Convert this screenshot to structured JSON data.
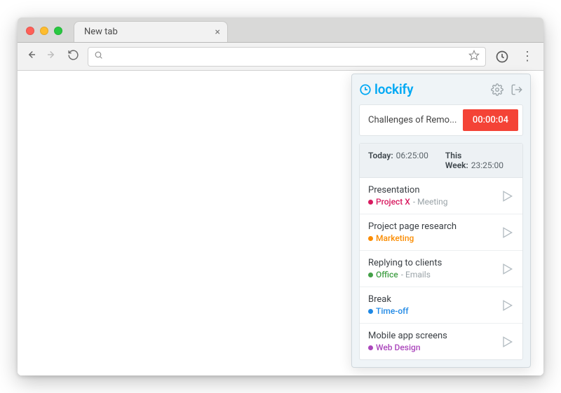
{
  "browser": {
    "tab_title": "New tab",
    "address_value": "",
    "address_placeholder": ""
  },
  "popup": {
    "brand": "lockify",
    "current": {
      "description": "Challenges of Remo...",
      "elapsed": "00:00:04"
    },
    "summary": {
      "today_label": "Today:",
      "today_value": "06:25:00",
      "week_label": "This Week:",
      "week_value": "23:25:00"
    },
    "entries": [
      {
        "title": "Presentation",
        "project": "Project X",
        "project_color": "#d81b60",
        "task": "Meeting"
      },
      {
        "title": "Project page research",
        "project": "Marketing",
        "project_color": "#fb8c00",
        "task": ""
      },
      {
        "title": "Replying to clients",
        "project": "Office",
        "project_color": "#43a047",
        "task": "Emails"
      },
      {
        "title": "Break",
        "project": "Time-off",
        "project_color": "#1e88e5",
        "task": ""
      },
      {
        "title": "Mobile app screens",
        "project": "Web Design",
        "project_color": "#ab47bc",
        "task": ""
      }
    ]
  }
}
